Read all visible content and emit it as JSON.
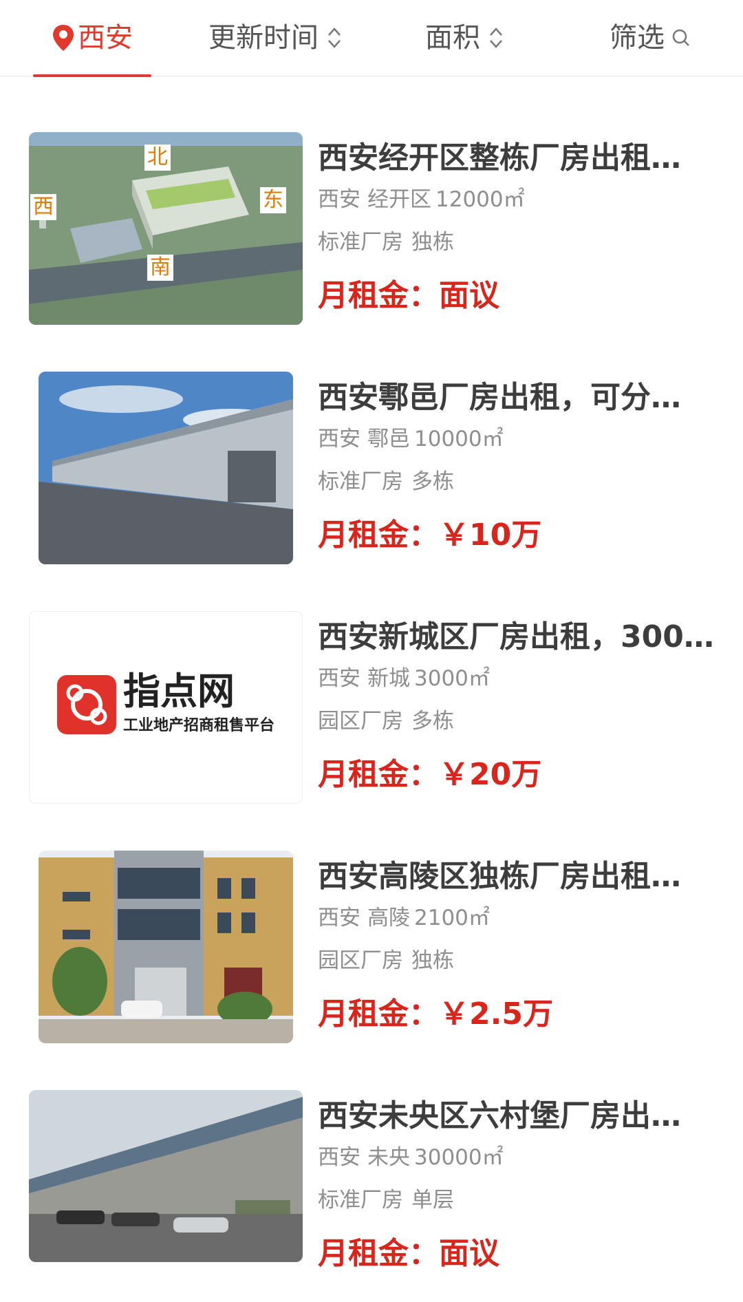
{
  "filters": {
    "city": "西安",
    "sort_time": "更新时间",
    "sort_area": "面积",
    "filter": "筛选"
  },
  "colors": {
    "accent": "#e03a2e",
    "price": "#d9261c",
    "muted": "#8e8e8e"
  },
  "listings": [
    {
      "title": "西安经开区整栋厂房出租…",
      "city": "西安",
      "district": "经开区",
      "area": "12000㎡",
      "tag1": "标准厂房",
      "tag2": "独栋",
      "price_label": "月租金：",
      "price": "面议",
      "map_labels": {
        "n": "北",
        "w": "西",
        "e": "东",
        "s": "南"
      }
    },
    {
      "title": "西安鄠邑厂房出租，可分…",
      "city": "西安",
      "district": "鄠邑",
      "area": "10000㎡",
      "tag1": "标准厂房",
      "tag2": "多栋",
      "price_label": "月租金：",
      "price": "￥10万"
    },
    {
      "title": "西安新城区厂房出租，300…",
      "city": "西安",
      "district": "新城",
      "area": "3000㎡",
      "tag1": "园区厂房",
      "tag2": "多栋",
      "price_label": "月租金：",
      "price": "￥20万",
      "logo": {
        "name": "指点网",
        "slogan": "工业地产招商租售平台"
      }
    },
    {
      "title": "西安高陵区独栋厂房出租…",
      "city": "西安",
      "district": "高陵",
      "area": "2100㎡",
      "tag1": "园区厂房",
      "tag2": "独栋",
      "price_label": "月租金：",
      "price": "￥2.5万"
    },
    {
      "title": "西安未央区六村堡厂房出…",
      "city": "西安",
      "district": "未央",
      "area": "30000㎡",
      "tag1": "标准厂房",
      "tag2": "单层",
      "price_label": "月租金：",
      "price": "面议"
    }
  ]
}
